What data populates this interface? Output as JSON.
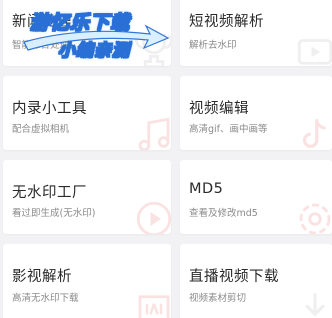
{
  "tools": [
    {
      "title": "新闻处理",
      "subtitle": "智能综合处理",
      "icon": "trophy-icon"
    },
    {
      "title": "短视频解析",
      "subtitle": "解析去水印",
      "icon": "video-icon"
    },
    {
      "title": "内录小工具",
      "subtitle": "配合虚拟相机",
      "icon": "music-note-icon"
    },
    {
      "title": "视频编辑",
      "subtitle": "高清gif、画中画等",
      "icon": "tiktok-icon"
    },
    {
      "title": "无水印工厂",
      "subtitle": "看过即生成(无水印)",
      "icon": "play-icon"
    },
    {
      "title": "MD5",
      "subtitle": "查看及修改md5",
      "icon": "settings-icon"
    },
    {
      "title": "影视解析",
      "subtitle": "高清无水印下载",
      "icon": "iqiyi-icon"
    },
    {
      "title": "直播视频下载",
      "subtitle": "视频素材剪切",
      "icon": "download-icon"
    }
  ],
  "watermark": {
    "line1": "游忆乐下载",
    "line2": "小编亲测"
  },
  "colors": {
    "background": "#f2f2f4",
    "card": "#ffffff",
    "title": "#2a2a2a",
    "subtitle": "#8a8a8a",
    "deco_gray": "#9a9a9a",
    "deco_red": "#e14a4a",
    "watermark_blue": "#2a6fd6"
  }
}
